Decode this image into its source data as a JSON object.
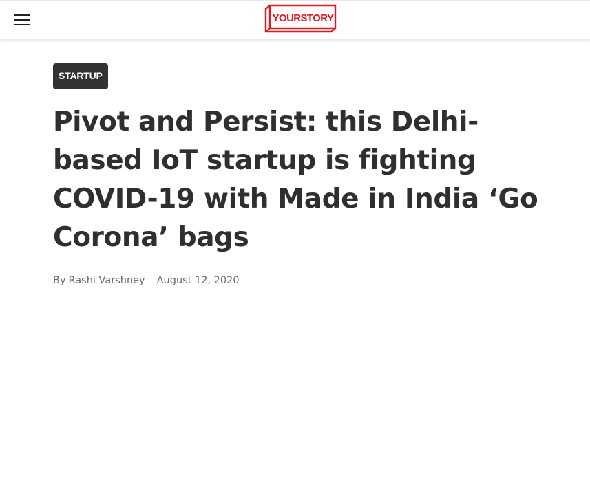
{
  "header": {
    "menu_icon": "hamburger-menu-icon",
    "logo_text": "YOURSTORY",
    "logo_color": "#e0181f"
  },
  "article": {
    "category": "STARTUP",
    "title": "Pivot and Persist: this Delhi-based IoT startup is fighting COVID-19 with Made in India ‘Go Corona’ bags",
    "byline_prefix": "By",
    "author": "Rashi Varshney",
    "date": "August 12, 2020"
  },
  "colors": {
    "category_bg": "#333333",
    "title_text": "#2f2f2f",
    "meta_text": "#6b6b6b"
  }
}
